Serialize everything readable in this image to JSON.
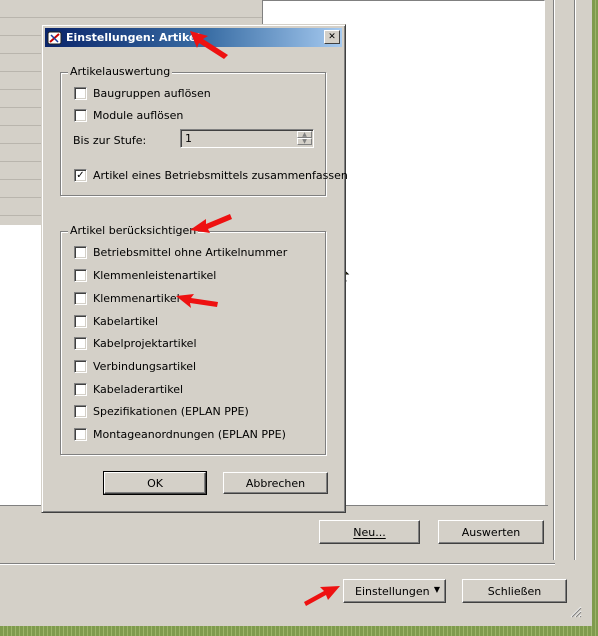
{
  "dialog": {
    "title": "Einstellungen: Artikel",
    "close_glyph": "✕",
    "group1": {
      "label": "Artikelauswertung",
      "items": [
        {
          "label": "Baugruppen auflösen",
          "checked": false
        },
        {
          "label": "Module auflösen",
          "checked": false
        }
      ],
      "level_label": "Bis zur Stufe:",
      "level_value": "1",
      "combine": {
        "label": "Artikel eines Betriebsmittels zusammenfassen",
        "checked": true
      }
    },
    "group2": {
      "label": "Artikel berücksichtigen",
      "items": [
        {
          "label": "Betriebsmittel ohne Artikelnummer",
          "checked": false
        },
        {
          "label": "Klemmenleistenartikel",
          "checked": false
        },
        {
          "label": "Klemmenartikel",
          "checked": false
        },
        {
          "label": "Kabelartikel",
          "checked": false
        },
        {
          "label": "Kabelprojektartikel",
          "checked": false
        },
        {
          "label": "Verbindungsartikel",
          "checked": false
        },
        {
          "label": "Kabeladerartikel",
          "checked": false
        },
        {
          "label": "Spezifikationen (EPLAN PPE)",
          "checked": false
        },
        {
          "label": "Montageanordnungen (EPLAN PPE)",
          "checked": false
        }
      ]
    },
    "ok_label": "OK",
    "cancel_label": "Abbrechen"
  },
  "main_window": {
    "new_label": "Neu...",
    "evaluate_label": "Auswerten",
    "settings_label": "Einstellungen",
    "settings_dropdown_glyph": "▼",
    "close_label": "Schließen"
  },
  "colors": {
    "annotation_arrow": "#ee1111",
    "titlebar_start": "#0a246a",
    "titlebar_end": "#a6caf0",
    "dialog_face": "#d4d0c8"
  }
}
